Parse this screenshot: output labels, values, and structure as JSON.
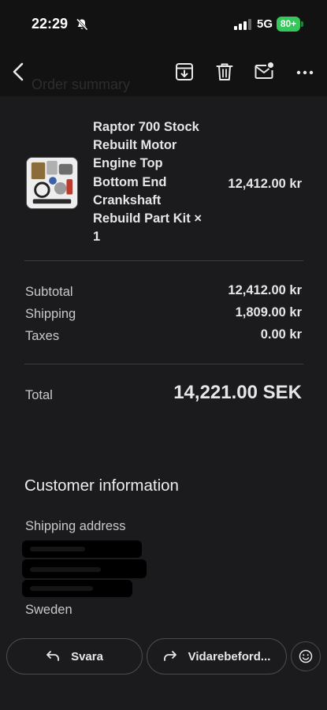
{
  "status_bar": {
    "time": "22:29",
    "network": "5G",
    "battery": "80+",
    "battery_color": "#34c759"
  },
  "toolbar": {
    "icons": [
      "back-icon",
      "archive-icon",
      "trash-icon",
      "mail-unread-icon",
      "more-icon"
    ],
    "ghost_title": "Order summary"
  },
  "order": {
    "product_name": "Raptor 700 Stock Rebuilt Motor Engine Top Bottom End Crankshaft Rebuild Part Kit × 1",
    "product_price": "12,412.00 kr",
    "rows": [
      {
        "label": "Subtotal",
        "value": "12,412.00 kr"
      },
      {
        "label": "Shipping",
        "value": "1,809.00 kr"
      },
      {
        "label": "Taxes",
        "value": "0.00 kr"
      }
    ],
    "total_label": "Total",
    "total_value": "14,221.00 SEK"
  },
  "customer": {
    "title": "Customer information",
    "shipping_label": "Shipping address",
    "country": "Sweden"
  },
  "actions": {
    "reply_label": "Svara",
    "forward_label": "Vidarebeford..."
  }
}
